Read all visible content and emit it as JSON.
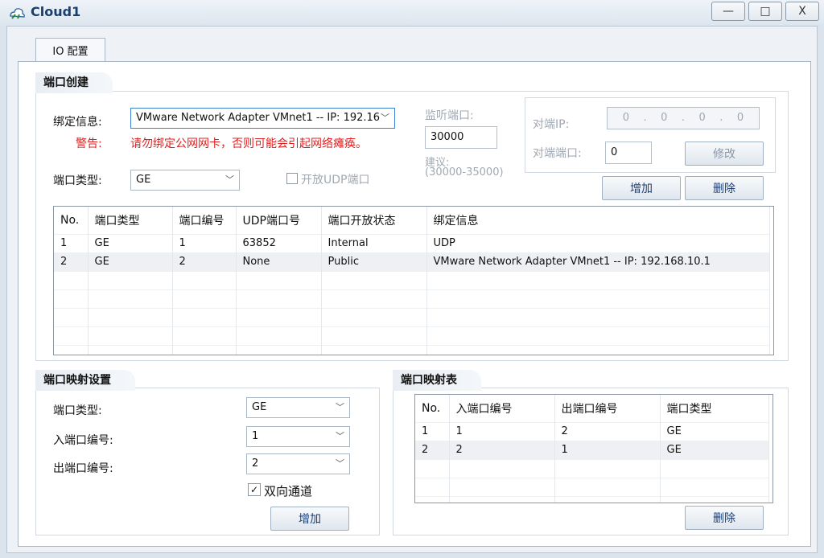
{
  "window": {
    "title": "Cloud1",
    "minimize": "—",
    "maximize": "□",
    "close": "X"
  },
  "tabs": [
    {
      "label": "IO 配置",
      "active": true
    }
  ],
  "port_create": {
    "title": "端口创建",
    "binding_label": "绑定信息:",
    "binding_value": "VMware Network Adapter VMnet1 -- IP: 192.16",
    "warning_label": "警告:",
    "warning_text": "请勿绑定公网网卡，否则可能会引起网络瘫痪。",
    "port_type_label": "端口类型:",
    "port_type_value": "GE",
    "udp_checkbox_label": "开放UDP端口",
    "listen_port_label": "监听端口:",
    "listen_port_value": "30000",
    "suggest_label": "建议:",
    "suggest_range": "(30000-35000)",
    "peer_ip_label": "对端IP:",
    "peer_ip_value": [
      "0",
      "0",
      "0",
      "0"
    ],
    "peer_port_label": "对端端口:",
    "peer_port_value": "0",
    "modify_button": "修改",
    "add_button": "增加",
    "delete_button": "删除",
    "table": {
      "columns": [
        "No.",
        "端口类型",
        "端口编号",
        "UDP端口号",
        "端口开放状态",
        "绑定信息"
      ],
      "rows": [
        [
          "1",
          "GE",
          "1",
          "63852",
          "Internal",
          "UDP"
        ],
        [
          "2",
          "GE",
          "2",
          "None",
          "Public",
          "VMware Network Adapter VMnet1 -- IP: 192.168.10.1"
        ]
      ]
    }
  },
  "mapping_settings": {
    "title": "端口映射设置",
    "port_type_label": "端口类型:",
    "port_type_value": "GE",
    "in_port_label": "入端口编号:",
    "in_port_value": "1",
    "out_port_label": "出端口编号:",
    "out_port_value": "2",
    "bidirectional_label": "双向通道",
    "bidirectional_checked": true,
    "add_button": "增加"
  },
  "mapping_table": {
    "title": "端口映射表",
    "columns": [
      "No.",
      "入端口编号",
      "出端口编号",
      "端口类型"
    ],
    "rows": [
      [
        "1",
        "1",
        "2",
        "GE"
      ],
      [
        "2",
        "2",
        "1",
        "GE"
      ]
    ],
    "delete_button": "删除"
  },
  "icons": {
    "app": "cloud-cable-icon",
    "dropdown": "chevron-down-icon"
  },
  "colors": {
    "warning": "#e02020",
    "accent": "#1b3f7a",
    "focus": "#3c7fd1"
  }
}
